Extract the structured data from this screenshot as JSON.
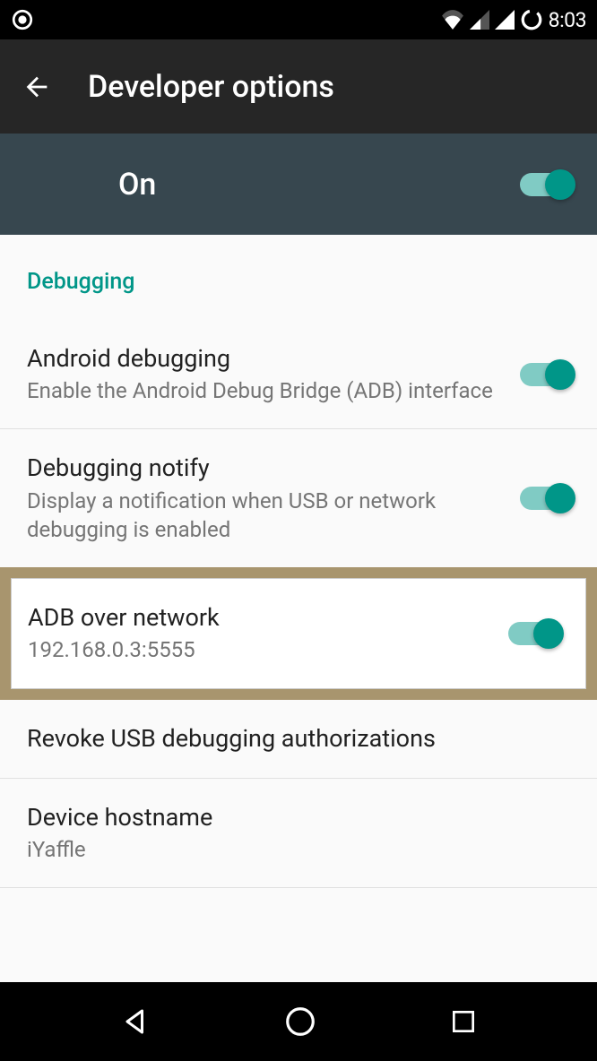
{
  "status_bar": {
    "time": "8:03"
  },
  "header": {
    "title": "Developer options"
  },
  "master_toggle": {
    "label": "On",
    "state": true
  },
  "section_header": "Debugging",
  "settings": {
    "android_debugging": {
      "title": "Android debugging",
      "subtitle": "Enable the Android Debug Bridge (ADB) interface",
      "state": true
    },
    "debugging_notify": {
      "title": "Debugging notify",
      "subtitle": "Display a notification when USB or network debugging is enabled",
      "state": true
    },
    "adb_over_network": {
      "title": "ADB over network",
      "subtitle": "192.168.0.3:5555",
      "state": true
    },
    "revoke_usb": {
      "title": "Revoke USB debugging authorizations"
    },
    "device_hostname": {
      "title": "Device hostname",
      "subtitle": "iYaffle"
    }
  }
}
